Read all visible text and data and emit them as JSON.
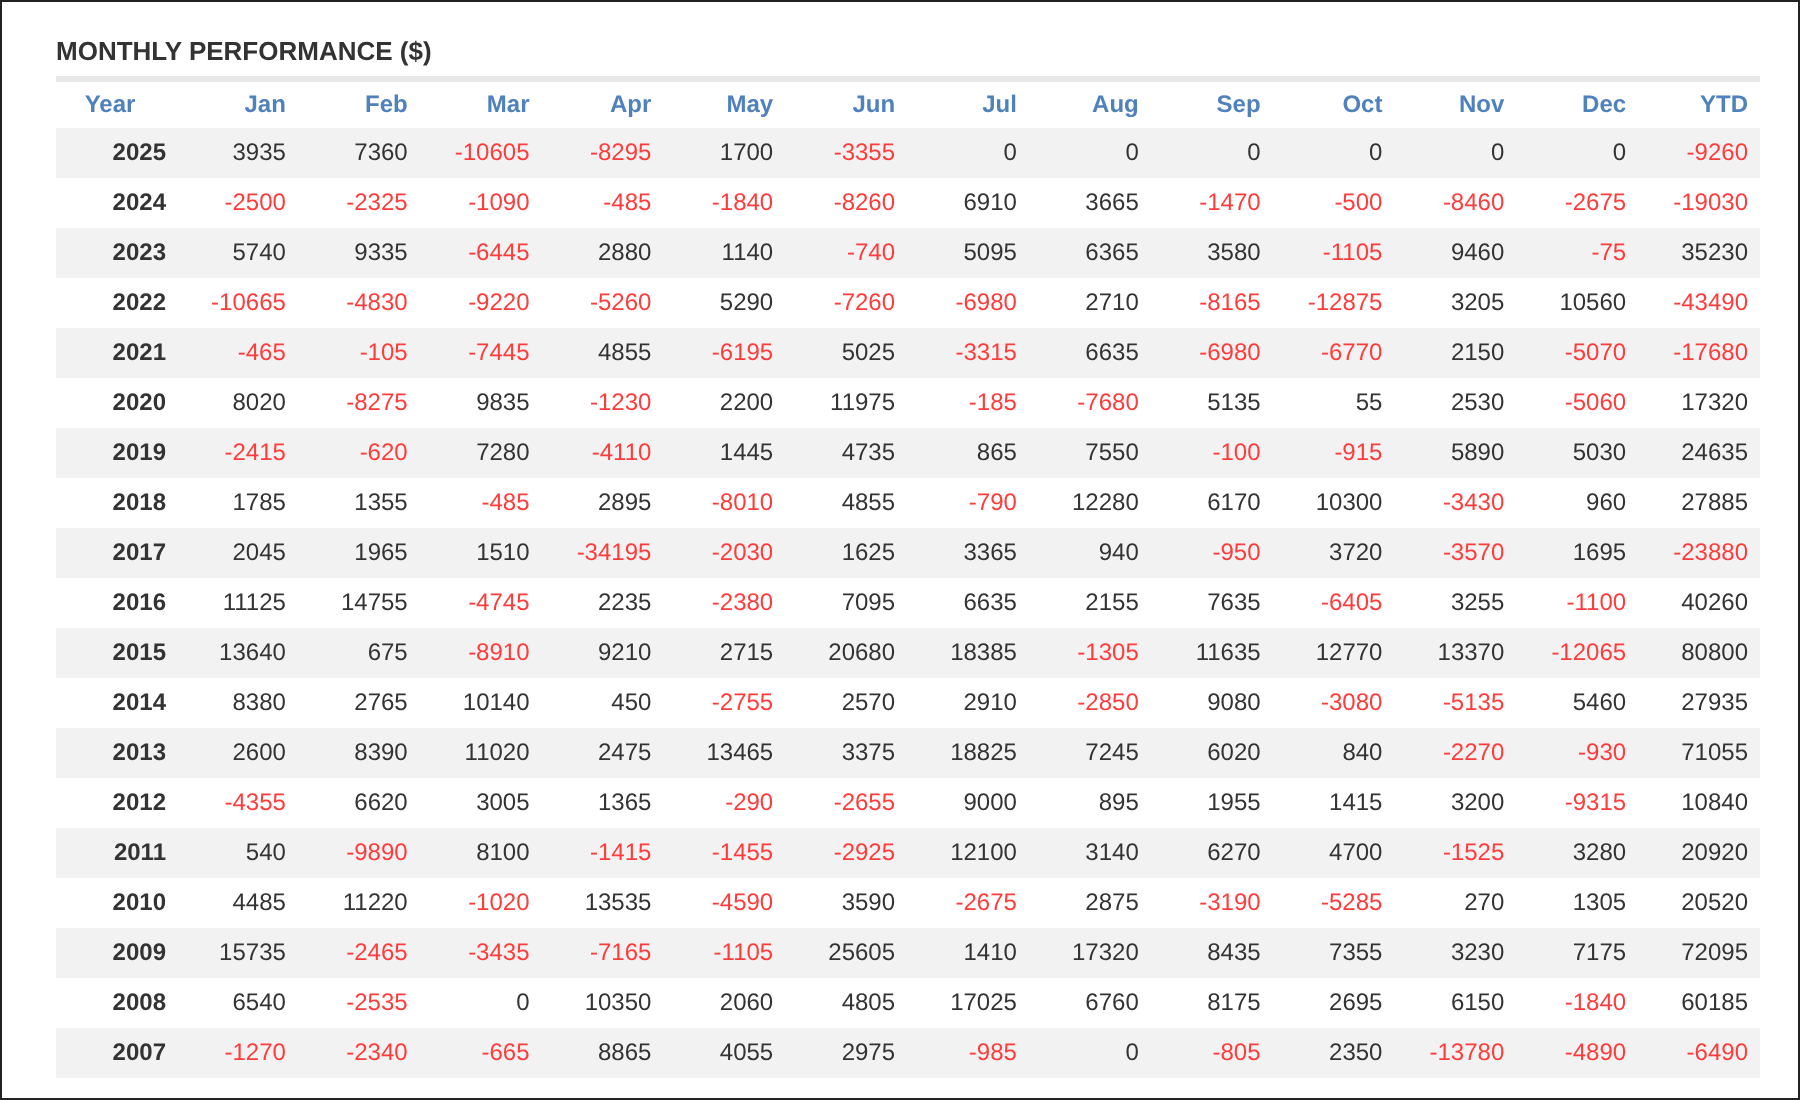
{
  "title": "MONTHLY PERFORMANCE ($)",
  "columns": [
    "Year",
    "Jan",
    "Feb",
    "Mar",
    "Apr",
    "May",
    "Jun",
    "Jul",
    "Aug",
    "Sep",
    "Oct",
    "Nov",
    "Dec",
    "YTD"
  ],
  "rows": [
    {
      "year": "2025",
      "cells": [
        {
          "value": "3935",
          "negative": false
        },
        {
          "value": "7360",
          "negative": false
        },
        {
          "value": "-10605",
          "negative": true
        },
        {
          "value": "-8295",
          "negative": true
        },
        {
          "value": "1700",
          "negative": false
        },
        {
          "value": "-3355",
          "negative": true
        },
        {
          "value": "0",
          "negative": false
        },
        {
          "value": "0",
          "negative": false
        },
        {
          "value": "0",
          "negative": false
        },
        {
          "value": "0",
          "negative": false
        },
        {
          "value": "0",
          "negative": false
        },
        {
          "value": "0",
          "negative": false
        },
        {
          "value": "-9260",
          "negative": true
        }
      ]
    },
    {
      "year": "2024",
      "cells": [
        {
          "value": "-2500",
          "negative": true
        },
        {
          "value": "-2325",
          "negative": true
        },
        {
          "value": "-1090",
          "negative": true
        },
        {
          "value": "-485",
          "negative": true
        },
        {
          "value": "-1840",
          "negative": true
        },
        {
          "value": "-8260",
          "negative": true
        },
        {
          "value": "6910",
          "negative": false
        },
        {
          "value": "3665",
          "negative": false
        },
        {
          "value": "-1470",
          "negative": true
        },
        {
          "value": "-500",
          "negative": true
        },
        {
          "value": "-8460",
          "negative": true
        },
        {
          "value": "-2675",
          "negative": true
        },
        {
          "value": "-19030",
          "negative": true
        }
      ]
    },
    {
      "year": "2023",
      "cells": [
        {
          "value": "5740",
          "negative": false
        },
        {
          "value": "9335",
          "negative": false
        },
        {
          "value": "-6445",
          "negative": true
        },
        {
          "value": "2880",
          "negative": false
        },
        {
          "value": "1140",
          "negative": false
        },
        {
          "value": "-740",
          "negative": true
        },
        {
          "value": "5095",
          "negative": false
        },
        {
          "value": "6365",
          "negative": false
        },
        {
          "value": "3580",
          "negative": false
        },
        {
          "value": "-1105",
          "negative": true
        },
        {
          "value": "9460",
          "negative": false
        },
        {
          "value": "-75",
          "negative": true
        },
        {
          "value": "35230",
          "negative": false
        }
      ]
    },
    {
      "year": "2022",
      "cells": [
        {
          "value": "-10665",
          "negative": true
        },
        {
          "value": "-4830",
          "negative": true
        },
        {
          "value": "-9220",
          "negative": true
        },
        {
          "value": "-5260",
          "negative": true
        },
        {
          "value": "5290",
          "negative": false
        },
        {
          "value": "-7260",
          "negative": true
        },
        {
          "value": "-6980",
          "negative": true
        },
        {
          "value": "2710",
          "negative": false
        },
        {
          "value": "-8165",
          "negative": true
        },
        {
          "value": "-12875",
          "negative": true
        },
        {
          "value": "3205",
          "negative": false
        },
        {
          "value": "10560",
          "negative": false
        },
        {
          "value": "-43490",
          "negative": true
        }
      ]
    },
    {
      "year": "2021",
      "cells": [
        {
          "value": "-465",
          "negative": true
        },
        {
          "value": "-105",
          "negative": true
        },
        {
          "value": "-7445",
          "negative": true
        },
        {
          "value": "4855",
          "negative": false
        },
        {
          "value": "-6195",
          "negative": true
        },
        {
          "value": "5025",
          "negative": false
        },
        {
          "value": "-3315",
          "negative": true
        },
        {
          "value": "6635",
          "negative": false
        },
        {
          "value": "-6980",
          "negative": true
        },
        {
          "value": "-6770",
          "negative": true
        },
        {
          "value": "2150",
          "negative": false
        },
        {
          "value": "-5070",
          "negative": true
        },
        {
          "value": "-17680",
          "negative": true
        }
      ]
    },
    {
      "year": "2020",
      "cells": [
        {
          "value": "8020",
          "negative": false
        },
        {
          "value": "-8275",
          "negative": true
        },
        {
          "value": "9835",
          "negative": false
        },
        {
          "value": "-1230",
          "negative": true
        },
        {
          "value": "2200",
          "negative": false
        },
        {
          "value": "11975",
          "negative": false
        },
        {
          "value": "-185",
          "negative": true
        },
        {
          "value": "-7680",
          "negative": true
        },
        {
          "value": "5135",
          "negative": false
        },
        {
          "value": "55",
          "negative": false
        },
        {
          "value": "2530",
          "negative": false
        },
        {
          "value": "-5060",
          "negative": true
        },
        {
          "value": "17320",
          "negative": false
        }
      ]
    },
    {
      "year": "2019",
      "cells": [
        {
          "value": "-2415",
          "negative": true
        },
        {
          "value": "-620",
          "negative": true
        },
        {
          "value": "7280",
          "negative": false
        },
        {
          "value": "-4110",
          "negative": true
        },
        {
          "value": "1445",
          "negative": false
        },
        {
          "value": "4735",
          "negative": false
        },
        {
          "value": "865",
          "negative": false
        },
        {
          "value": "7550",
          "negative": false
        },
        {
          "value": "-100",
          "negative": true
        },
        {
          "value": "-915",
          "negative": true
        },
        {
          "value": "5890",
          "negative": false
        },
        {
          "value": "5030",
          "negative": false
        },
        {
          "value": "24635",
          "negative": false
        }
      ]
    },
    {
      "year": "2018",
      "cells": [
        {
          "value": "1785",
          "negative": false
        },
        {
          "value": "1355",
          "negative": false
        },
        {
          "value": "-485",
          "negative": true
        },
        {
          "value": "2895",
          "negative": false
        },
        {
          "value": "-8010",
          "negative": true
        },
        {
          "value": "4855",
          "negative": false
        },
        {
          "value": "-790",
          "negative": true
        },
        {
          "value": "12280",
          "negative": false
        },
        {
          "value": "6170",
          "negative": false
        },
        {
          "value": "10300",
          "negative": false
        },
        {
          "value": "-3430",
          "negative": true
        },
        {
          "value": "960",
          "negative": false
        },
        {
          "value": "27885",
          "negative": false
        }
      ]
    },
    {
      "year": "2017",
      "cells": [
        {
          "value": "2045",
          "negative": false
        },
        {
          "value": "1965",
          "negative": false
        },
        {
          "value": "1510",
          "negative": false
        },
        {
          "value": "-34195",
          "negative": true
        },
        {
          "value": "-2030",
          "negative": true
        },
        {
          "value": "1625",
          "negative": false
        },
        {
          "value": "3365",
          "negative": false
        },
        {
          "value": "940",
          "negative": false
        },
        {
          "value": "-950",
          "negative": true
        },
        {
          "value": "3720",
          "negative": false
        },
        {
          "value": "-3570",
          "negative": true
        },
        {
          "value": "1695",
          "negative": false
        },
        {
          "value": "-23880",
          "negative": true
        }
      ]
    },
    {
      "year": "2016",
      "cells": [
        {
          "value": "11125",
          "negative": false
        },
        {
          "value": "14755",
          "negative": false
        },
        {
          "value": "-4745",
          "negative": true
        },
        {
          "value": "2235",
          "negative": false
        },
        {
          "value": "-2380",
          "negative": true
        },
        {
          "value": "7095",
          "negative": false
        },
        {
          "value": "6635",
          "negative": false
        },
        {
          "value": "2155",
          "negative": false
        },
        {
          "value": "7635",
          "negative": false
        },
        {
          "value": "-6405",
          "negative": true
        },
        {
          "value": "3255",
          "negative": false
        },
        {
          "value": "-1100",
          "negative": true
        },
        {
          "value": "40260",
          "negative": false
        }
      ]
    },
    {
      "year": "2015",
      "cells": [
        {
          "value": "13640",
          "negative": false
        },
        {
          "value": "675",
          "negative": false
        },
        {
          "value": "-8910",
          "negative": true
        },
        {
          "value": "9210",
          "negative": false
        },
        {
          "value": "2715",
          "negative": false
        },
        {
          "value": "20680",
          "negative": false
        },
        {
          "value": "18385",
          "negative": false
        },
        {
          "value": "-1305",
          "negative": true
        },
        {
          "value": "11635",
          "negative": false
        },
        {
          "value": "12770",
          "negative": false
        },
        {
          "value": "13370",
          "negative": false
        },
        {
          "value": "-12065",
          "negative": true
        },
        {
          "value": "80800",
          "negative": false
        }
      ]
    },
    {
      "year": "2014",
      "cells": [
        {
          "value": "8380",
          "negative": false
        },
        {
          "value": "2765",
          "negative": false
        },
        {
          "value": "10140",
          "negative": false
        },
        {
          "value": "450",
          "negative": false
        },
        {
          "value": "-2755",
          "negative": true
        },
        {
          "value": "2570",
          "negative": false
        },
        {
          "value": "2910",
          "negative": false
        },
        {
          "value": "-2850",
          "negative": true
        },
        {
          "value": "9080",
          "negative": false
        },
        {
          "value": "-3080",
          "negative": true
        },
        {
          "value": "-5135",
          "negative": true
        },
        {
          "value": "5460",
          "negative": false
        },
        {
          "value": "27935",
          "negative": false
        }
      ]
    },
    {
      "year": "2013",
      "cells": [
        {
          "value": "2600",
          "negative": false
        },
        {
          "value": "8390",
          "negative": false
        },
        {
          "value": "11020",
          "negative": false
        },
        {
          "value": "2475",
          "negative": false
        },
        {
          "value": "13465",
          "negative": false
        },
        {
          "value": "3375",
          "negative": false
        },
        {
          "value": "18825",
          "negative": false
        },
        {
          "value": "7245",
          "negative": false
        },
        {
          "value": "6020",
          "negative": false
        },
        {
          "value": "840",
          "negative": false
        },
        {
          "value": "-2270",
          "negative": true
        },
        {
          "value": "-930",
          "negative": true
        },
        {
          "value": "71055",
          "negative": false
        }
      ]
    },
    {
      "year": "2012",
      "cells": [
        {
          "value": "-4355",
          "negative": true
        },
        {
          "value": "6620",
          "negative": false
        },
        {
          "value": "3005",
          "negative": false
        },
        {
          "value": "1365",
          "negative": false
        },
        {
          "value": "-290",
          "negative": true
        },
        {
          "value": "-2655",
          "negative": true
        },
        {
          "value": "9000",
          "negative": false
        },
        {
          "value": "895",
          "negative": false
        },
        {
          "value": "1955",
          "negative": false
        },
        {
          "value": "1415",
          "negative": false
        },
        {
          "value": "3200",
          "negative": false
        },
        {
          "value": "-9315",
          "negative": true
        },
        {
          "value": "10840",
          "negative": false
        }
      ]
    },
    {
      "year": "2011",
      "cells": [
        {
          "value": "540",
          "negative": false
        },
        {
          "value": "-9890",
          "negative": true
        },
        {
          "value": "8100",
          "negative": false
        },
        {
          "value": "-1415",
          "negative": true
        },
        {
          "value": "-1455",
          "negative": true
        },
        {
          "value": "-2925",
          "negative": true
        },
        {
          "value": "12100",
          "negative": false
        },
        {
          "value": "3140",
          "negative": false
        },
        {
          "value": "6270",
          "negative": false
        },
        {
          "value": "4700",
          "negative": false
        },
        {
          "value": "-1525",
          "negative": true
        },
        {
          "value": "3280",
          "negative": false
        },
        {
          "value": "20920",
          "negative": false
        }
      ]
    },
    {
      "year": "2010",
      "cells": [
        {
          "value": "4485",
          "negative": false
        },
        {
          "value": "11220",
          "negative": false
        },
        {
          "value": "-1020",
          "negative": true
        },
        {
          "value": "13535",
          "negative": false
        },
        {
          "value": "-4590",
          "negative": true
        },
        {
          "value": "3590",
          "negative": false
        },
        {
          "value": "-2675",
          "negative": true
        },
        {
          "value": "2875",
          "negative": false
        },
        {
          "value": "-3190",
          "negative": true
        },
        {
          "value": "-5285",
          "negative": true
        },
        {
          "value": "270",
          "negative": false
        },
        {
          "value": "1305",
          "negative": false
        },
        {
          "value": "20520",
          "negative": false
        }
      ]
    },
    {
      "year": "2009",
      "cells": [
        {
          "value": "15735",
          "negative": false
        },
        {
          "value": "-2465",
          "negative": true
        },
        {
          "value": "-3435",
          "negative": true
        },
        {
          "value": "-7165",
          "negative": true
        },
        {
          "value": "-1105",
          "negative": true
        },
        {
          "value": "25605",
          "negative": false
        },
        {
          "value": "1410",
          "negative": false
        },
        {
          "value": "17320",
          "negative": false
        },
        {
          "value": "8435",
          "negative": false
        },
        {
          "value": "7355",
          "negative": false
        },
        {
          "value": "3230",
          "negative": false
        },
        {
          "value": "7175",
          "negative": false
        },
        {
          "value": "72095",
          "negative": false
        }
      ]
    },
    {
      "year": "2008",
      "cells": [
        {
          "value": "6540",
          "negative": false
        },
        {
          "value": "-2535",
          "negative": true
        },
        {
          "value": "0",
          "negative": false
        },
        {
          "value": "10350",
          "negative": false
        },
        {
          "value": "2060",
          "negative": false
        },
        {
          "value": "4805",
          "negative": false
        },
        {
          "value": "17025",
          "negative": false
        },
        {
          "value": "6760",
          "negative": false
        },
        {
          "value": "8175",
          "negative": false
        },
        {
          "value": "2695",
          "negative": false
        },
        {
          "value": "6150",
          "negative": false
        },
        {
          "value": "-1840",
          "negative": true
        },
        {
          "value": "60185",
          "negative": false
        }
      ]
    },
    {
      "year": "2007",
      "cells": [
        {
          "value": "-1270",
          "negative": true
        },
        {
          "value": "-2340",
          "negative": true
        },
        {
          "value": "-665",
          "negative": true
        },
        {
          "value": "8865",
          "negative": false
        },
        {
          "value": "4055",
          "negative": false
        },
        {
          "value": "2975",
          "negative": false
        },
        {
          "value": "-985",
          "negative": true
        },
        {
          "value": "0",
          "negative": false
        },
        {
          "value": "-805",
          "negative": true
        },
        {
          "value": "2350",
          "negative": false
        },
        {
          "value": "-13780",
          "negative": true
        },
        {
          "value": "-4890",
          "negative": true
        },
        {
          "value": "-6490",
          "negative": true
        }
      ]
    }
  ]
}
